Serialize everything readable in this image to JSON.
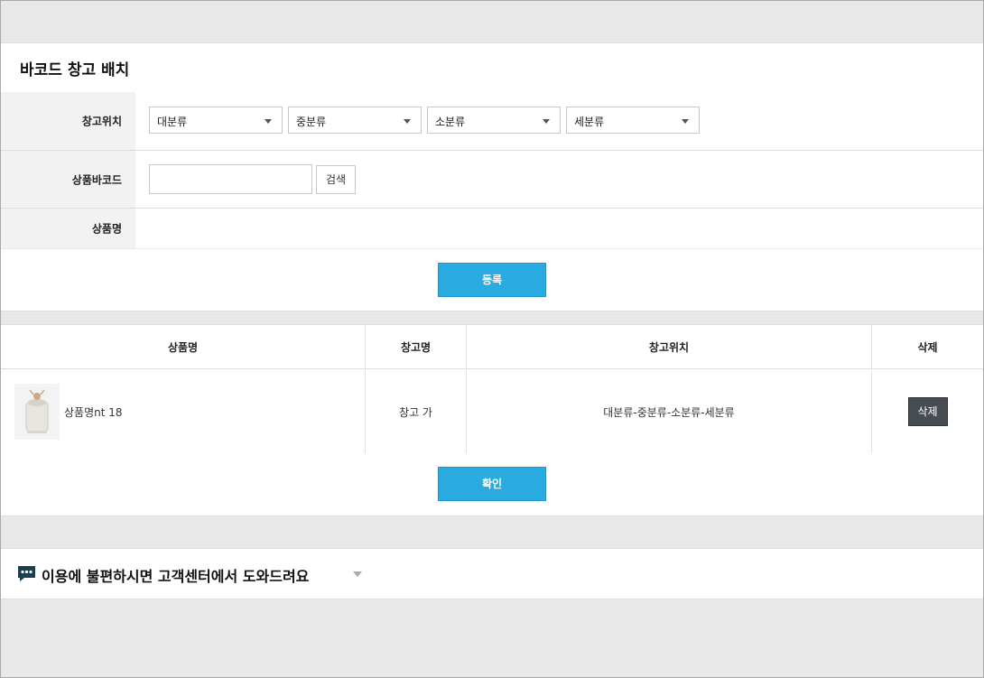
{
  "page": {
    "title": "바코드 창고 배치"
  },
  "form": {
    "location_label": "창고위치",
    "selects": [
      "대분류",
      "중분류",
      "소분류",
      "세분류"
    ],
    "barcode_label": "상품바코드",
    "barcode_value": "",
    "search_label": "검색",
    "product_name_label": "상품명",
    "product_name_value": "",
    "register_label": "등록"
  },
  "table": {
    "headers": [
      "상품명",
      "창고명",
      "창고위치",
      "삭제"
    ],
    "rows": [
      {
        "product": "상품명nt 18",
        "warehouse": "창고 가",
        "location": "대분류-중분류-소분류-세분류",
        "delete": "삭제"
      }
    ]
  },
  "confirm_label": "확인",
  "help": {
    "text": "이용에 불편하시면 고객센터에서 도와드려요",
    "icon": "chat-bubble-icon"
  },
  "colors": {
    "primary": "#29abe2",
    "dark_button": "#474c53",
    "label_bg": "#f2f2f2",
    "page_bg": "#e8e8e8"
  }
}
